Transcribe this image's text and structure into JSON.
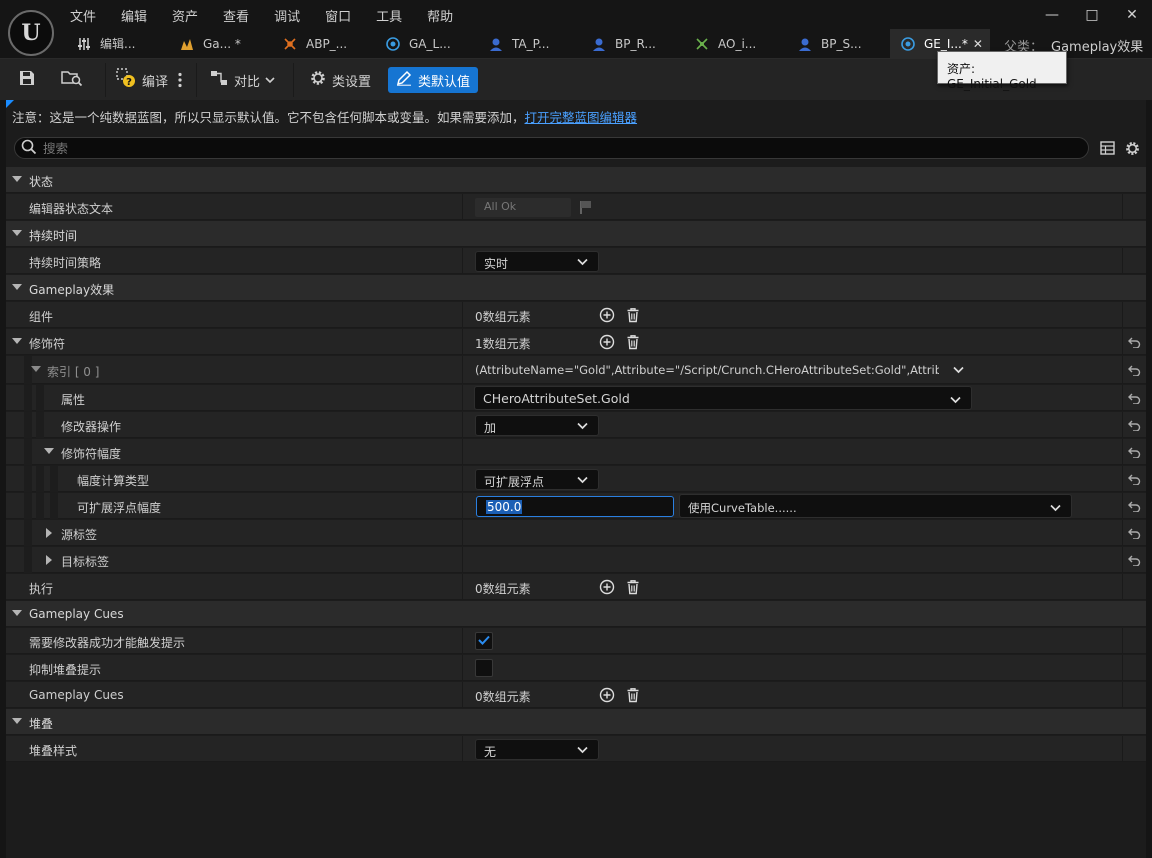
{
  "menu": [
    "文件",
    "编辑",
    "资产",
    "查看",
    "调试",
    "窗口",
    "工具",
    "帮助"
  ],
  "tabs": [
    {
      "label": "编辑...",
      "icon": "sliders-icon",
      "color": "#d0d0d0"
    },
    {
      "label": "Ga...   *",
      "icon": "anim-icon",
      "color": "#e0a030"
    },
    {
      "label": "ABP_...",
      "icon": "anim-bp-icon",
      "color": "#e07020"
    },
    {
      "label": "GA_L...",
      "icon": "blueprint-icon",
      "color": "#3a9be0"
    },
    {
      "label": "TA_P...",
      "icon": "blueprint-icon",
      "color": "#3a9be0"
    },
    {
      "label": "BP_R...",
      "icon": "character-icon",
      "color": "#3a7be0"
    },
    {
      "label": "AO_i...",
      "icon": "aim-offset-icon",
      "color": "#6ab04c"
    },
    {
      "label": "BP_S...",
      "icon": "character-icon",
      "color": "#3a7be0"
    },
    {
      "label": "GE_I...*",
      "icon": "blueprint-icon",
      "color": "#3a9be0"
    }
  ],
  "parent_class": {
    "label": "父类：",
    "value": "Gameplay效果"
  },
  "tooltip": "资产: GE_Initial_Gold",
  "toolbar": {
    "compile": "编译",
    "diff": "对比",
    "class_settings": "类设置",
    "class_defaults": "类默认值"
  },
  "notice": {
    "text": "注意：这是一个纯数据蓝图，所以只显示默认值。它不包含任何脚本或变量。如果需要添加，",
    "link": "打开完整蓝图编辑器"
  },
  "search": {
    "placeholder": "搜索"
  },
  "rows": {
    "status_cat": "状态",
    "editor_status": "编辑器状态文本",
    "editor_status_value": "All Ok",
    "duration_cat": "持续时间",
    "duration_policy": "持续时间策略",
    "duration_policy_value": "实时",
    "gameplay_effect_cat": "Gameplay效果",
    "components": "组件",
    "components_value": "0数组元素",
    "modifiers": "修饰符",
    "modifiers_value": "1数组元素",
    "index0": "索引 [ 0 ]",
    "index0_value": "(AttributeName=\"Gold\",Attribute=\"/Script/Crunch.CHeroAttributeSet:Gold\",AttributeOwner=\"/",
    "attribute": "属性",
    "attribute_value": "CHeroAttributeSet.Gold",
    "mod_op": "修改器操作",
    "mod_op_value": "加",
    "magnitude": "修饰符幅度",
    "calc_type": "幅度计算类型",
    "calc_type_value": "可扩展浮点",
    "scalable_magnitude": "可扩展浮点幅度",
    "scalable_magnitude_value": "500.0",
    "curve_table": "使用CurveTable......",
    "source_tags": "源标签",
    "target_tags": "目标标签",
    "executions": "执行",
    "executions_value": "0数组元素",
    "cues_cat": "Gameplay Cues",
    "require_success": "需要修改器成功才能触发提示",
    "suppress_stacking": "抑制堆叠提示",
    "gameplay_cues": "Gameplay Cues",
    "gameplay_cues_value": "0数组元素",
    "stacking_cat": "堆叠",
    "stacking_type": "堆叠样式",
    "stacking_type_value": "无"
  },
  "colors": {
    "accent": "#1675d2",
    "link": "#4aa0ff"
  }
}
